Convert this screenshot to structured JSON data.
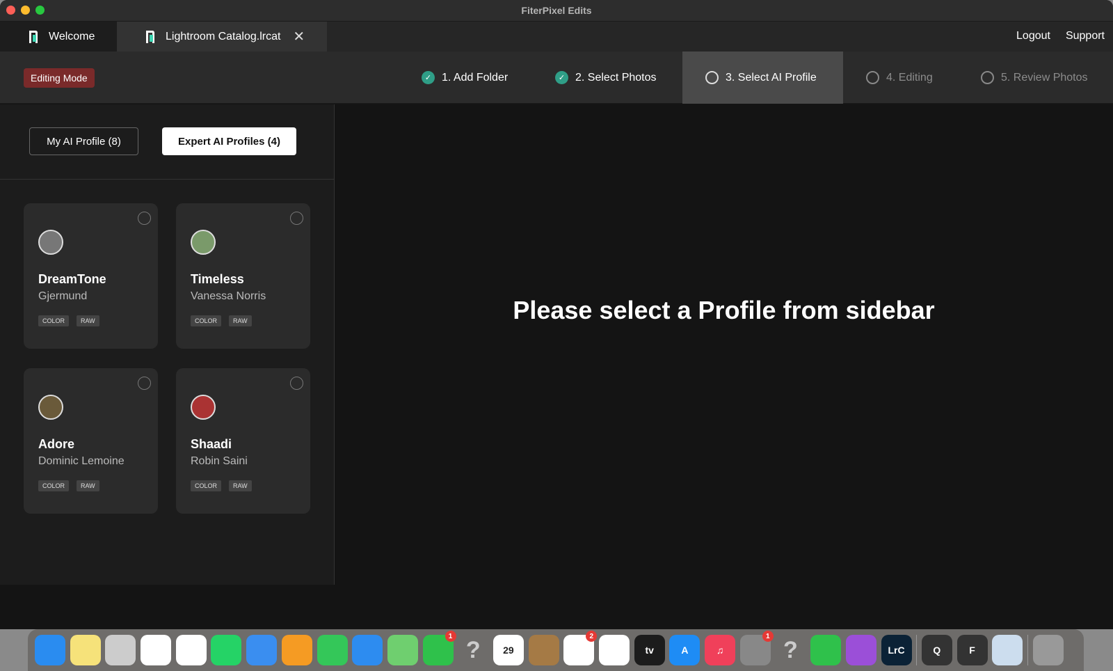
{
  "window": {
    "title": "FiterPixel Edits"
  },
  "tabs": [
    {
      "label": "Welcome"
    },
    {
      "label": "Lightroom Catalog.lrcat"
    }
  ],
  "header_links": {
    "logout": "Logout",
    "support": "Support"
  },
  "mode_badge": "Editing Mode",
  "steps": [
    {
      "label": "1. Add Folder",
      "status": "done"
    },
    {
      "label": "2. Select Photos",
      "status": "done"
    },
    {
      "label": "3. Select AI Profile",
      "status": "active"
    },
    {
      "label": "4. Editing",
      "status": "pending"
    },
    {
      "label": "5. Review Photos",
      "status": "pending"
    }
  ],
  "sidebar": {
    "my_profiles": "My AI Profile (8)",
    "expert_profiles": "Expert AI Profiles (4)",
    "cards": [
      {
        "name": "DreamTone",
        "author": "Gjermund",
        "tags": [
          "COLOR",
          "RAW"
        ]
      },
      {
        "name": "Timeless",
        "author": "Vanessa Norris",
        "tags": [
          "COLOR",
          "RAW"
        ]
      },
      {
        "name": "Adore",
        "author": "Dominic Lemoine",
        "tags": [
          "COLOR",
          "RAW"
        ]
      },
      {
        "name": "Shaadi",
        "author": "Robin Saini",
        "tags": [
          "COLOR",
          "RAW"
        ]
      }
    ]
  },
  "main": {
    "message": "Please select a Profile from sidebar"
  },
  "colors": {
    "accent": "#2f9e87",
    "badge": "#7a2a2a"
  },
  "dock": [
    {
      "name": "finder",
      "color": "#2a8cf0"
    },
    {
      "name": "notes",
      "color": "#f6e27a"
    },
    {
      "name": "launchpad",
      "color": "#ccc"
    },
    {
      "name": "photos",
      "color": "#fff"
    },
    {
      "name": "chrome",
      "color": "#fff"
    },
    {
      "name": "whatsapp",
      "color": "#25d366"
    },
    {
      "name": "safari",
      "color": "#3a8ef0"
    },
    {
      "name": "pages",
      "color": "#f59b23"
    },
    {
      "name": "messages",
      "color": "#34c759"
    },
    {
      "name": "mail",
      "color": "#2d8cf0"
    },
    {
      "name": "maps",
      "color": "#6fcf6f"
    },
    {
      "name": "facetime",
      "color": "#2fc14b",
      "badge": "1"
    },
    {
      "name": "unknown",
      "color": "transparent",
      "label": "?"
    },
    {
      "name": "calendar",
      "color": "#fff",
      "label": "29"
    },
    {
      "name": "contacts",
      "color": "#a57a45"
    },
    {
      "name": "reminders",
      "color": "#fff",
      "badge": "2"
    },
    {
      "name": "freeform",
      "color": "#fff"
    },
    {
      "name": "apple-tv",
      "color": "#1c1c1c",
      "label": "tv"
    },
    {
      "name": "app-store",
      "color": "#1e8cf5",
      "label": "A"
    },
    {
      "name": "music",
      "color": "#f0405a",
      "label": "♫"
    },
    {
      "name": "system-settings",
      "color": "#888",
      "badge": "1"
    },
    {
      "name": "unknown",
      "color": "transparent",
      "label": "?"
    },
    {
      "name": "numbers",
      "color": "#2fc14b"
    },
    {
      "name": "podcasts",
      "color": "#9b4fd8"
    },
    {
      "name": "lightroom-classic",
      "color": "#0b2236",
      "label": "LrC"
    },
    {
      "name": "quicktime",
      "color": "#333",
      "label": "Q"
    },
    {
      "name": "fiterpixel",
      "color": "#333",
      "label": "F"
    },
    {
      "name": "preview",
      "color": "#cde"
    },
    {
      "name": "trash",
      "color": "#999"
    }
  ]
}
